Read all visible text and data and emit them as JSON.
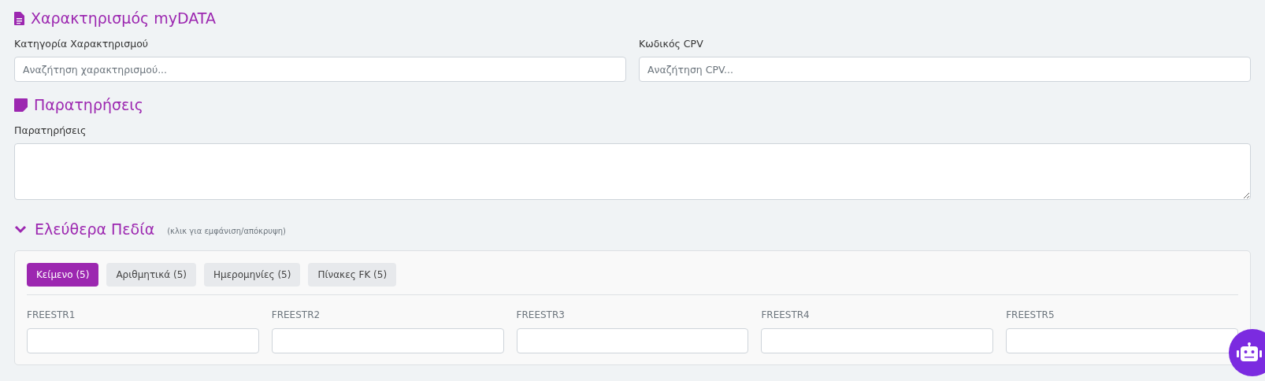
{
  "mydata_section": {
    "title": "Χαρακτηρισμός myDATA",
    "fields": [
      {
        "label": "Κατηγορία Χαρακτηρισμού",
        "placeholder": "Αναζήτηση χαρακτηρισμού..."
      },
      {
        "label": "Κωδικός CPV",
        "placeholder": "Αναζήτηση CPV..."
      }
    ]
  },
  "notes_section": {
    "title": "Παρατηρήσεις",
    "label": "Παρατηρήσεις"
  },
  "free_fields": {
    "title": "Ελεύθερα Πεδία",
    "hint": "(κλικ για εμφάνιση/απόκρυψη)",
    "expanded": true,
    "tabs": [
      {
        "label": "Κείμενο (5)",
        "selected": true
      },
      {
        "label": "Αριθμητικά (5)",
        "selected": false
      },
      {
        "label": "Ημερομηνίες (5)",
        "selected": false
      },
      {
        "label": "Πίνακες FK (5)",
        "selected": false
      }
    ],
    "fields": [
      {
        "label": "FREESTR1"
      },
      {
        "label": "FREESTR2"
      },
      {
        "label": "FREESTR3"
      },
      {
        "label": "FREESTR4"
      },
      {
        "label": "FREESTR5"
      }
    ]
  }
}
